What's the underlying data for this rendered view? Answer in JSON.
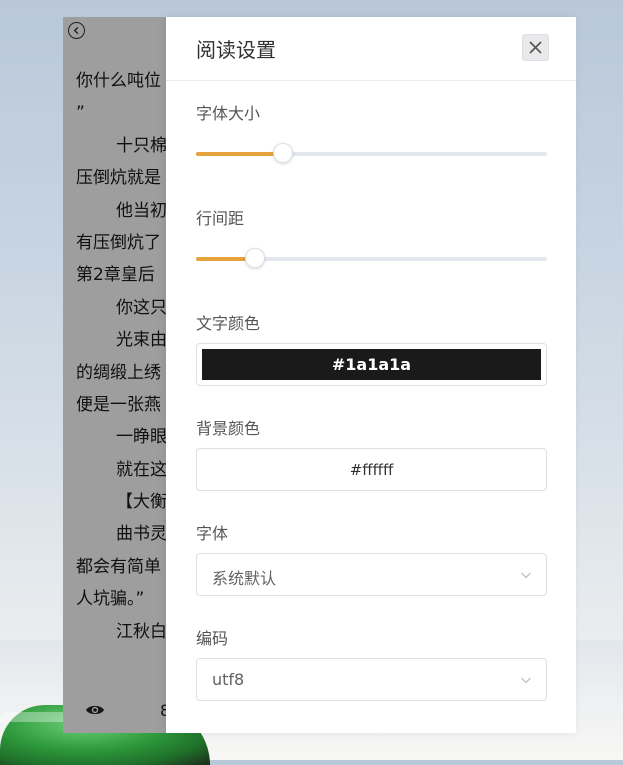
{
  "reader": {
    "lines": [
      {
        "text": "你什么吨位",
        "indent": false
      },
      {
        "text": "”",
        "indent": false
      },
      {
        "text": "十只棉",
        "indent": true
      },
      {
        "text": "压倒炕就是",
        "indent": false
      },
      {
        "text": "他当初",
        "indent": true
      },
      {
        "text": "有压倒炕了",
        "indent": false
      },
      {
        "text": "第2章皇后",
        "indent": false
      },
      {
        "text": "你这只",
        "indent": true
      },
      {
        "text": "光束由",
        "indent": true
      },
      {
        "text": "的绸缎上绣",
        "indent": false
      },
      {
        "text": "便是一张燕",
        "indent": false
      },
      {
        "text": "一睁眼",
        "indent": true
      },
      {
        "text": "就在这",
        "indent": true
      },
      {
        "text": "【大衡",
        "indent": true
      },
      {
        "text": "曲书灵",
        "indent": true
      },
      {
        "text": "都会有简单",
        "indent": false
      },
      {
        "text": "人坑骗。”",
        "indent": false
      },
      {
        "text": "江秋白",
        "indent": true
      }
    ],
    "bottom_glyph": "8"
  },
  "panel": {
    "title": "阅读设置",
    "font_size": {
      "label": "字体大小",
      "value_fraction": 0.25
    },
    "line_spacing": {
      "label": "行间距",
      "value_fraction": 0.17
    },
    "text_color": {
      "label": "文字颜色",
      "value": "#1a1a1a"
    },
    "bg_color": {
      "label": "背景颜色",
      "value": "#ffffff"
    },
    "font": {
      "label": "字体",
      "value": "系统默认"
    },
    "encoding": {
      "label": "编码",
      "value": "utf8"
    }
  },
  "colors": {
    "accent": "#e6a23c",
    "overlay": "rgba(0,0,0,0.38)"
  }
}
